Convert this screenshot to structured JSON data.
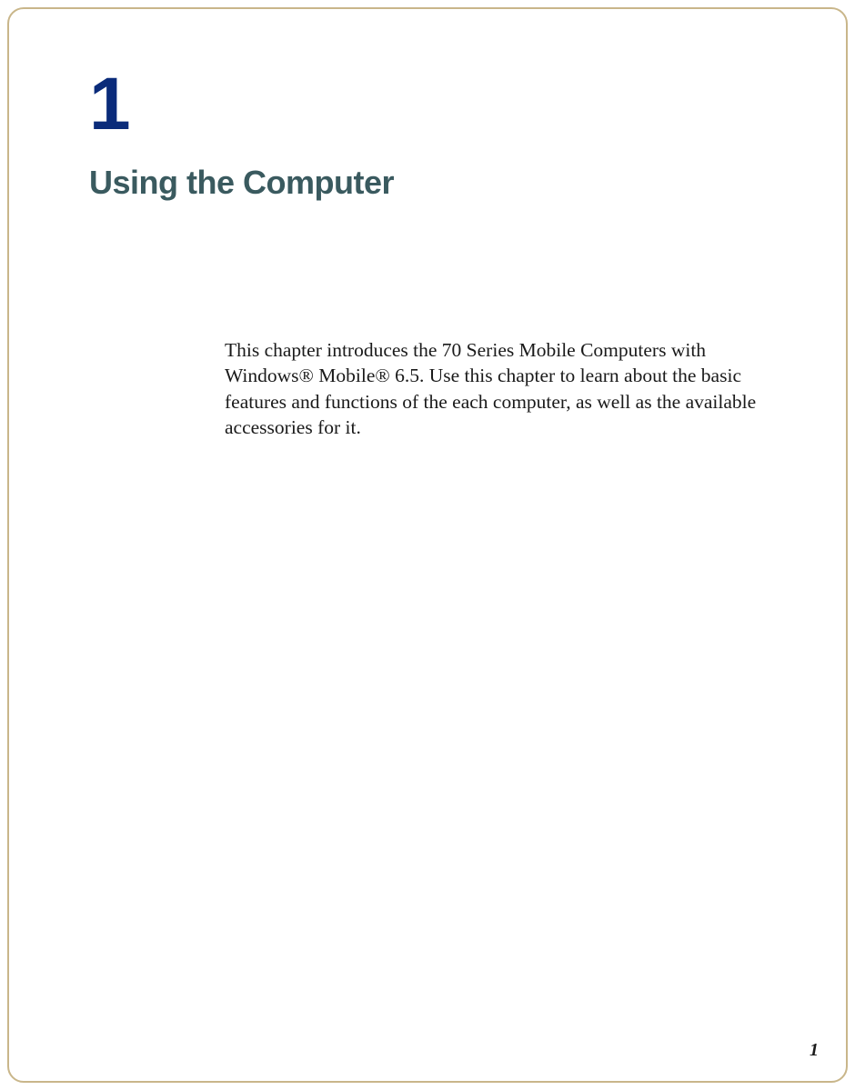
{
  "chapter": {
    "number": "1",
    "title": "Using the Computer",
    "intro": "This chapter introduces the 70 Series Mobile Computers with Windows® Mobile® 6.5. Use this chapter to learn about the basic features and functions of the each computer, as well as the available accessories for it."
  },
  "page_number": "1"
}
